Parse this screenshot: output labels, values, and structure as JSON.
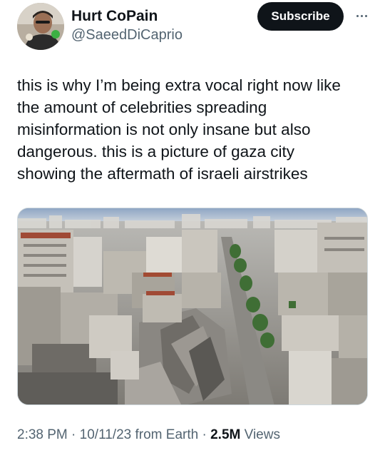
{
  "author": {
    "display_name": "Hurt CoPain",
    "handle": "@SaeedDiCaprio",
    "avatar_icon": "profile-photo"
  },
  "actions": {
    "subscribe_label": "Subscribe",
    "more_icon": "more-horizontal-icon"
  },
  "tweet": {
    "text_lines": [
      "this is why I’m being extra vocal right now like",
      "the amount of celebrities spreading",
      "misinformation is not only insane but also",
      "dangerous. this is a picture of gaza city",
      "showing the aftermath of israeli airstrikes"
    ]
  },
  "meta": {
    "time": "2:38 PM",
    "separator": "·",
    "date": "10/11/23",
    "source": "from Earth",
    "views_count": "2.5M",
    "views_label": "Views"
  },
  "colors": {
    "text_primary": "#0f1419",
    "text_secondary": "#536471",
    "button_bg": "#0f1419",
    "button_text": "#ffffff"
  }
}
